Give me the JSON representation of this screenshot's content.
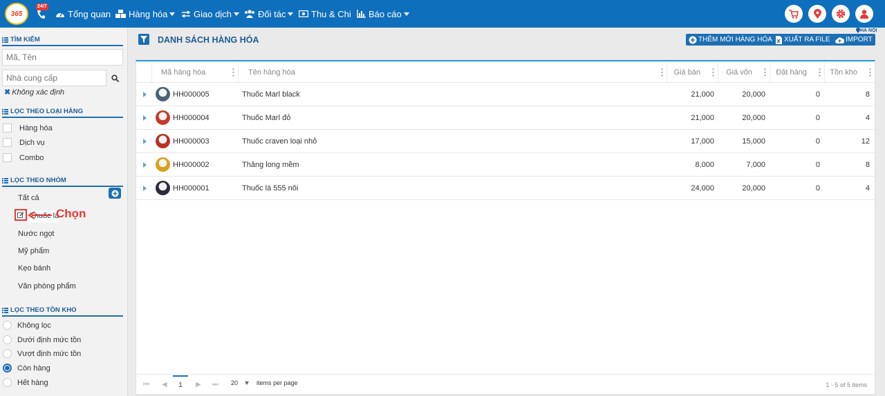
{
  "brand": {
    "logo_text": "365",
    "support_badge": "24/7"
  },
  "nav": [
    {
      "label": "Tổng quan",
      "icon": "dashboard-icon"
    },
    {
      "label": "Hàng hóa",
      "icon": "cubes-icon",
      "dropdown": true
    },
    {
      "label": "Giao dịch",
      "icon": "exchange-icon",
      "dropdown": true
    },
    {
      "label": "Đối tác",
      "icon": "users-icon",
      "dropdown": true
    },
    {
      "label": "Thu & Chi",
      "icon": "money-icon"
    },
    {
      "label": "Báo cáo",
      "icon": "bar-chart-icon",
      "dropdown": true
    }
  ],
  "header_buttons": [
    "cart-icon",
    "location-icon",
    "gear-icon",
    "user-icon"
  ],
  "sidebar": {
    "search_title": "TÌM KIẾM",
    "search_placeholder": "Mã, Tên",
    "supplier_placeholder": "Nhà cung cấp",
    "unknown_label": "Không xác định",
    "type_title": "LỌC THEO LOẠI HÀNG",
    "types": [
      "Hàng hóa",
      "Dịch vụ",
      "Combo"
    ],
    "group_title": "LỌC THEO NHÓM",
    "groups": [
      "Tất cả",
      "Thuốc lá",
      "Nước ngọt",
      "Mỹ phẩm",
      "Kẹo bánh",
      "Văn phòng phẩm"
    ],
    "annotation": "Chọn",
    "stock_title": "LỌC THEO TỒN KHO",
    "stock_options": [
      "Không lọc",
      "Dưới định mức tồn",
      "Vượt định mức tồn",
      "Còn hàng",
      "Hết hàng"
    ],
    "stock_selected": "Còn hàng"
  },
  "main": {
    "title": "DANH SÁCH HÀNG HÓA",
    "location": "HÀ NỘI",
    "buttons": {
      "add": "THÊM MỚI HÀNG HÓA",
      "export": "XUẤT RA FILE",
      "import": "IMPORT"
    },
    "columns": [
      "Mã hàng hóa",
      "Tên hàng hóa",
      "Giá bán",
      "Giá vốn",
      "Đặt hàng",
      "Tồn kho"
    ],
    "rows": [
      {
        "code": "HH000005",
        "name": "Thuốc Marl black",
        "price": "21,000",
        "cost": "20,000",
        "ordered": "0",
        "stock": "8",
        "thumb": "#4a6272"
      },
      {
        "code": "HH000004",
        "name": "Thuốc Marl đỏ",
        "price": "21,000",
        "cost": "20,000",
        "ordered": "0",
        "stock": "4",
        "thumb": "#c63a2b"
      },
      {
        "code": "HH000003",
        "name": "Thuốc craven loại nhỏ",
        "price": "17,000",
        "cost": "15,000",
        "ordered": "0",
        "stock": "12",
        "thumb": "#b83226"
      },
      {
        "code": "HH000002",
        "name": "Thăng long mềm",
        "price": "8,000",
        "cost": "7,000",
        "ordered": "0",
        "stock": "8",
        "thumb": "#d9a11c"
      },
      {
        "code": "HH000001",
        "name": "Thuốc lá 555 nôi",
        "price": "24,000",
        "cost": "20,000",
        "ordered": "0",
        "stock": "4",
        "thumb": "#2b2b3a"
      }
    ],
    "pager": {
      "current_page": "1",
      "page_size": "20",
      "per_label": "items per page",
      "summary": "1 - 5 of 5 items"
    }
  }
}
